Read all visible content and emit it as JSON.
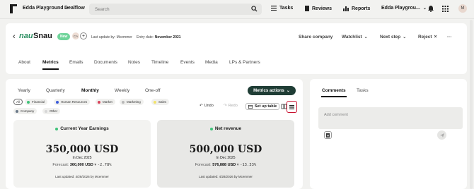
{
  "topbar": {
    "workspace": "Edda Playground",
    "section": "Dealflow",
    "search_placeholder": "Search",
    "nav": [
      "Tasks",
      "Reviews",
      "Reports"
    ],
    "org_switch": "Edda Playgrou...",
    "avatar": "M"
  },
  "company": {
    "brand": "nau",
    "name": "Snau",
    "badge": "New",
    "owner_initials": "CA",
    "last_update_label": "Last update by:",
    "last_update_value": "Mcemmer",
    "entry_date_label": "Entry date:",
    "entry_date_value": "November 2021",
    "actions": [
      "Share company",
      "Watchlist",
      "Next step",
      "Reject"
    ],
    "tabs": [
      "About",
      "Metrics",
      "Emails",
      "Documents",
      "Notes",
      "Timeline",
      "Events",
      "Media",
      "LPs & Partners"
    ],
    "active_tab": "Metrics"
  },
  "metrics": {
    "periods": [
      "Yearly",
      "Quarterly",
      "Monthly",
      "Weekly",
      "One-off"
    ],
    "active_period": "Monthly",
    "actions_label": "Metrics actions",
    "filters": [
      {
        "label": "All",
        "color": ""
      },
      {
        "label": "Financial",
        "color": "#3fc37a"
      },
      {
        "label": "Human Resources",
        "color": "#3b5bdb"
      },
      {
        "label": "Market",
        "color": "#d9425a"
      },
      {
        "label": "Marketing",
        "color": "#b8b8b8"
      },
      {
        "label": "Sales",
        "color": "#f3e36b"
      },
      {
        "label": "Company",
        "color": "#6b7a8a"
      },
      {
        "label": "Other",
        "color": "#d6d6d6"
      }
    ],
    "undo": "Undo",
    "redo": "Redo",
    "setup_table": "Set up table",
    "cards": [
      {
        "title": "Current Year Earnings",
        "value": "350,000 USD",
        "period": "In Dec 2025",
        "forecast_label": "Forecast:",
        "forecast_value": "360,000 USD",
        "change": "-2.78%",
        "updated": "Last updated: 4/28/2026 by Mcemmer",
        "bg": "#f3f3f1"
      },
      {
        "title": "Net revenue",
        "value": "500,000 USD",
        "period": "In Dec 2025",
        "forecast_label": "Forecast:",
        "forecast_value": "576,888 USD",
        "change": "-13.33%",
        "updated": "Last updated: 4/28/2026 by Mcemmer",
        "bg": "#e8e8e6"
      }
    ]
  },
  "side": {
    "tabs": [
      "Comments",
      "Tasks"
    ],
    "active_tab": "Comments",
    "comment_placeholder": "Add comment"
  }
}
